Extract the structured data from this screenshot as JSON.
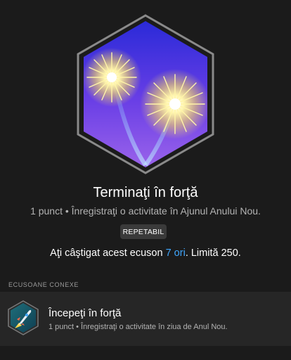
{
  "badge": {
    "title": "Terminaţi în forţă",
    "subtitle": "1 punct • Înregistraţi o activitate în Ajunul Anului Nou.",
    "tag": "REPETABIL",
    "earned_prefix": "Aţi câştigat acest ecuson ",
    "earned_count": "7 ori",
    "earned_suffix": ". Limită 250.",
    "icon": "fireworks-icon"
  },
  "related": {
    "section_label": "ECUSOANE CONEXE",
    "items": [
      {
        "title": "Începeţi în forţă",
        "description": "1 punct • Înregistraţi o activitate în ziua de Anul Nou.",
        "icon": "rocket-icon"
      }
    ]
  },
  "colors": {
    "background": "#1b1b1b",
    "accent": "#3fa7ff",
    "row_background": "#262626"
  }
}
